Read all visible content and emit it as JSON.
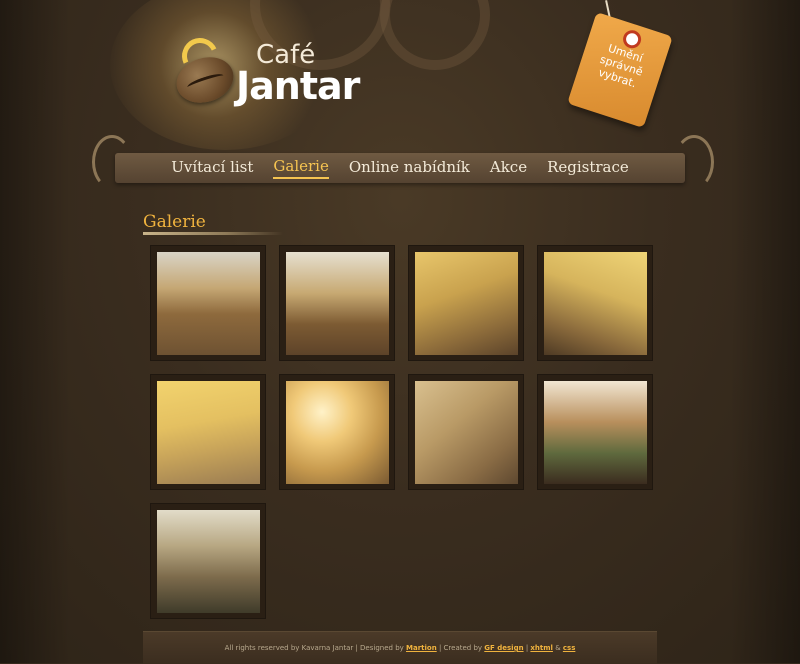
{
  "header": {
    "logo": {
      "cafe": "Café",
      "name": "Jantar"
    },
    "tag": {
      "text": "Umění správně vybrat."
    }
  },
  "nav": {
    "items": [
      {
        "label": "Uvítací list",
        "active": false
      },
      {
        "label": "Galerie",
        "active": true
      },
      {
        "label": "Online nabídník",
        "active": false
      },
      {
        "label": "Akce",
        "active": false
      },
      {
        "label": "Registrace",
        "active": false
      }
    ]
  },
  "page": {
    "title": "Galerie"
  },
  "gallery": {
    "photos": [
      {
        "subject": "attic-dining-room"
      },
      {
        "subject": "attic-tables-window"
      },
      {
        "subject": "armchair-and-table"
      },
      {
        "subject": "ornate-chair-table"
      },
      {
        "subject": "armchair-corner"
      },
      {
        "subject": "table-lamp"
      },
      {
        "subject": "armchair-closeup"
      },
      {
        "subject": "man-with-hookah"
      },
      {
        "subject": "guests-seated"
      }
    ]
  },
  "footer": {
    "rights": "All rights reserved by Kavarna Jantar | Designed by",
    "designer": "Martion",
    "created_prefix": "| Created by",
    "creator": "GF design",
    "sep1": "|",
    "xhtml": "xhtml",
    "amp": "&",
    "css": "css"
  },
  "colors": {
    "accent": "#f0b33e",
    "background": "#3a2d1f",
    "nav_bg": "#5f4c38"
  }
}
